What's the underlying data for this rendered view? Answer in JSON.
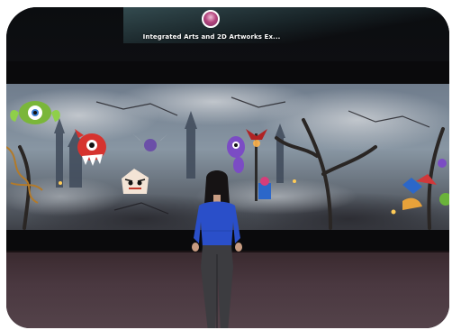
{
  "hud": {
    "room_title": "Integrated Arts and 2D Artworks Ex...",
    "host_avatar": "host-avatar-icon"
  },
  "scene": {
    "artwork": "halloween-monster-mural",
    "player": "player-avatar-woman-blue-top"
  },
  "colors": {
    "ceiling": "#0e0f12",
    "floor": "#4a3840",
    "player_top": "#2a4fc9",
    "player_pants": "#3c3c40"
  }
}
